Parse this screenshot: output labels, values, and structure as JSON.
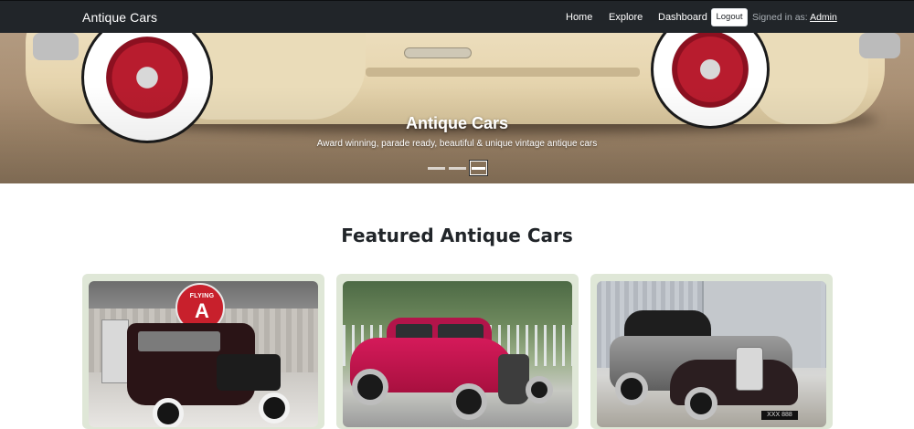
{
  "navbar": {
    "brand": "Antique Cars",
    "links": [
      {
        "label": "Home"
      },
      {
        "label": "Explore"
      },
      {
        "label": "Dashboard"
      }
    ],
    "logout_label": "Logout",
    "signed_in_prefix": "Signed in as:",
    "signed_in_user": "Admin",
    "background": "#212529"
  },
  "hero": {
    "title": "Antique Cars",
    "subtitle": "Award winning, parade ready, beautiful & unique vintage antique cars",
    "slide_count": 3,
    "active_slide": 3
  },
  "featured": {
    "heading": "Featured Antique Cars",
    "card_background": "#dfe7d7",
    "cards": [
      {
        "image": "black-maroon-sedan-photo",
        "sign_text": "FLYING",
        "sign_letter": "A"
      },
      {
        "image": "red-hot-rod-photo"
      },
      {
        "image": "grey-black-convertible-photo",
        "plate": "XXX 888"
      }
    ]
  }
}
